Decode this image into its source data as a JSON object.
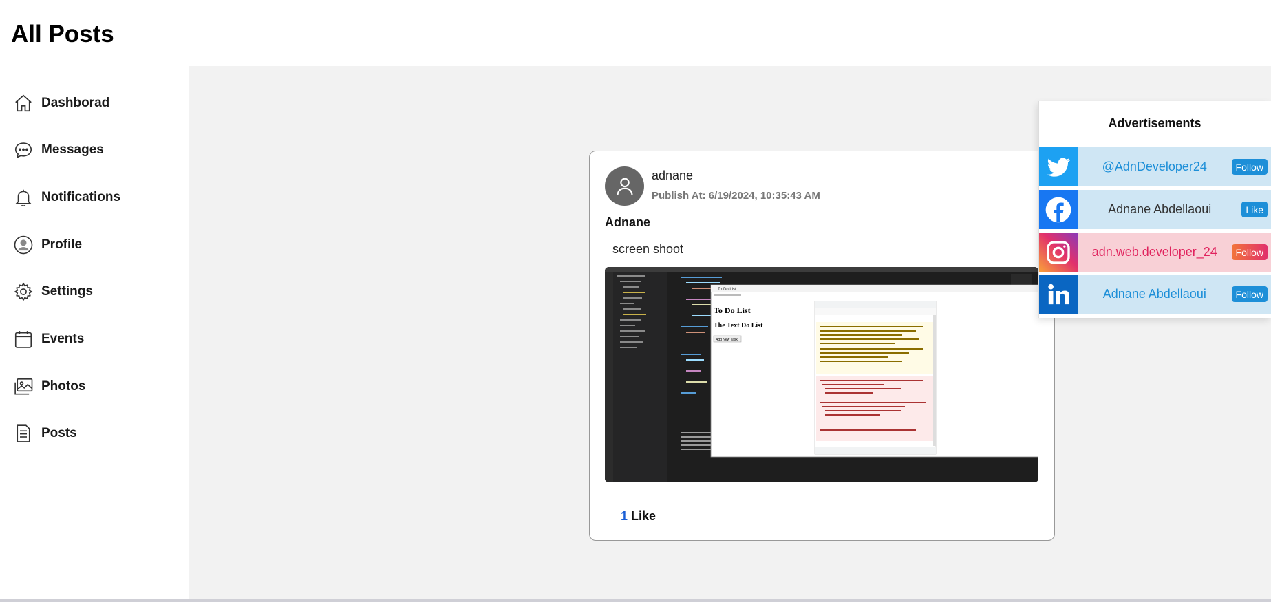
{
  "header": {
    "title": "All Posts"
  },
  "sidebar": {
    "items": [
      {
        "label": "Dashborad",
        "icon": "home-icon"
      },
      {
        "label": "Messages",
        "icon": "chat-bubble-icon"
      },
      {
        "label": "Notifications",
        "icon": "bell-icon"
      },
      {
        "label": "Profile",
        "icon": "user-circle-icon"
      },
      {
        "label": "Settings",
        "icon": "gear-icon"
      },
      {
        "label": "Events",
        "icon": "calendar-icon"
      },
      {
        "label": "Photos",
        "icon": "images-icon"
      },
      {
        "label": "Posts",
        "icon": "document-icon"
      }
    ]
  },
  "post": {
    "author": "adnane",
    "published": "Publish At: 6/19/2024, 10:35:43 AM",
    "title": "Adnane",
    "body": "screen shoot",
    "like_count": "1",
    "like_label": "Like",
    "screenshot": {
      "dialog_title": "To Do List",
      "heading": "To Do List",
      "subheading": "The Text Do List",
      "button": "Add New Task"
    }
  },
  "ads": {
    "title": "Advertisements",
    "items": [
      {
        "platform": "twitter",
        "handle": "@AdnDeveloper24",
        "action": "Follow",
        "bg": "#cfe6f4",
        "logo_bg": "#1da1f2",
        "text_color": "#1d8fd8",
        "btn_color": "#1d8fd8"
      },
      {
        "platform": "facebook",
        "handle": "Adnane Abdellaoui",
        "action": "Like",
        "bg": "#cfe6f4",
        "logo_bg": "#1877f2",
        "text_color": "#333333",
        "btn_color": "#1d8fd8"
      },
      {
        "platform": "instagram",
        "handle": "adn.web.developer_24",
        "action": "Follow",
        "bg": "#f8d0d6",
        "logo_bg": "#d6287a",
        "text_color": "#e0245e",
        "btn_color": "#e8405a"
      },
      {
        "platform": "linkedin",
        "handle": "Adnane Abdellaoui",
        "action": "Follow",
        "bg": "#cfe6f4",
        "logo_bg": "#0a66c2",
        "text_color": "#1d8fd8",
        "btn_color": "#1d8fd8"
      }
    ]
  }
}
